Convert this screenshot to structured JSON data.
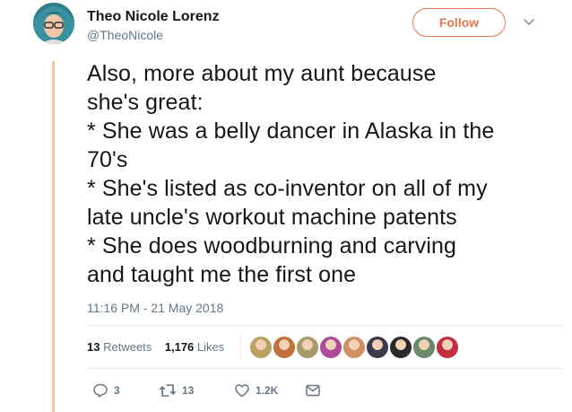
{
  "author": {
    "display_name": "Theo Nicole Lorenz",
    "handle": "@TheoNicole"
  },
  "follow_label": "Follow",
  "tweet": {
    "lines": [
      "Also, more about my aunt because",
      "she's great:",
      "* She was a belly dancer in Alaska in the",
      "70's",
      "* She's listed as co-inventor on all of my",
      "late uncle's workout machine patents",
      "* She does woodburning and carving",
      "and taught me the first one"
    ],
    "timestamp": "11:16 PM - 21 May 2018"
  },
  "stats": {
    "retweets_count": "13",
    "retweets_label": "Retweets",
    "likes_count": "1,176",
    "likes_label": "Likes"
  },
  "likers": [
    {
      "name": "liker-avatar-1",
      "color": "#b8a060"
    },
    {
      "name": "liker-avatar-2",
      "color": "#c0703a"
    },
    {
      "name": "liker-avatar-3",
      "color": "#a89a6a"
    },
    {
      "name": "liker-avatar-4",
      "color": "#b04a9a"
    },
    {
      "name": "liker-avatar-5",
      "color": "#d09060"
    },
    {
      "name": "liker-avatar-6",
      "color": "#3a3a4a"
    },
    {
      "name": "liker-avatar-7",
      "color": "#2a2a2a"
    },
    {
      "name": "liker-avatar-8",
      "color": "#6a8a6a"
    },
    {
      "name": "liker-avatar-9",
      "color": "#c03040"
    }
  ],
  "actions": {
    "reply_count": "3",
    "retweet_count": "13",
    "like_count": "1.2K"
  },
  "colors": {
    "accent": "#e8774c",
    "thread_line": "#f5c7a9",
    "muted": "#657786"
  },
  "icons": [
    "avatar",
    "chevron-down-icon",
    "reply-icon",
    "retweet-icon",
    "heart-icon",
    "message-icon"
  ]
}
